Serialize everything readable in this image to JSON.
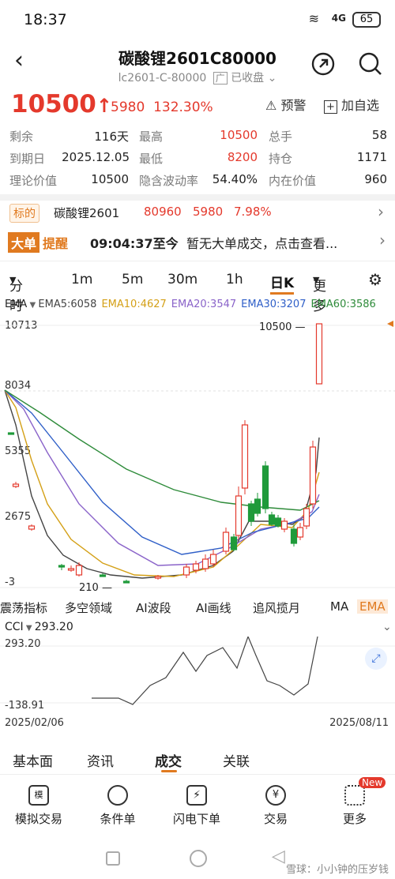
{
  "status_bar": {
    "time": "18:37",
    "battery": "65",
    "network": "4G"
  },
  "header": {
    "title": "碳酸锂2601C80000",
    "subtitle": "lc2601-C-80000",
    "exchange_tag": "广",
    "market_status": "已收盘"
  },
  "quote": {
    "price": "10500",
    "change": "5980",
    "change_pct": "132.30%",
    "alert_label": "预警",
    "watchlist_label": "加自选"
  },
  "stats": [
    {
      "label": "剩余",
      "value": "116天",
      "label2": "最高",
      "value2": "10500",
      "label3": "总手",
      "value3": "58"
    },
    {
      "label": "到期日",
      "value": "2025.12.05",
      "label2": "最低",
      "value2": "8200",
      "label3": "持仓",
      "value3": "1171"
    },
    {
      "label": "理论价值",
      "value": "10500",
      "label2": "隐含波动率",
      "value2": "54.40%",
      "label3": "内在价值",
      "value3": "960"
    }
  ],
  "underlying": {
    "tag": "标的",
    "name": "碳酸锂2601",
    "price": "80960",
    "change": "5980",
    "change_pct": "7.98%"
  },
  "big_order": {
    "tag1": "大单",
    "tag2": "提醒",
    "time": "09:04:37至今",
    "message": "暂无大单成交，点击查看..."
  },
  "periods": [
    "分时",
    "1m",
    "5m",
    "30m",
    "1h",
    "日K",
    "更多"
  ],
  "active_period": "日K",
  "ema_legend": {
    "name": "EMA",
    "items": [
      {
        "label": "EMA5:6058",
        "color": "#444444"
      },
      {
        "label": "EMA10:4627",
        "color": "#d4a017"
      },
      {
        "label": "EMA20:3547",
        "color": "#8a63c9"
      },
      {
        "label": "EMA30:3207",
        "color": "#2f5fc8"
      },
      {
        "label": "EMA60:3586",
        "color": "#2e8b3a"
      }
    ]
  },
  "price_axis": [
    "10713",
    "8034",
    "5355",
    "2675",
    "-3"
  ],
  "annotations": {
    "high": "10500",
    "low": "210"
  },
  "tools": [
    "震荡指标",
    "多空领域",
    "AI波段",
    "AI画线",
    "追风揽月",
    "MA",
    "EMA"
  ],
  "cci": {
    "name": "CCI",
    "value": "293.20",
    "top": "293.20",
    "bottom": "-138.91"
  },
  "dates": {
    "start": "2025/02/06",
    "end": "2025/08/11"
  },
  "bottom_tabs": [
    "基本面",
    "资讯",
    "成交",
    "关联"
  ],
  "active_bottom_tab": "成交",
  "bottom_bar": [
    {
      "label": "模拟交易",
      "icon": "simulate-trade-icon"
    },
    {
      "label": "条件单",
      "icon": "cloud-condition-icon"
    },
    {
      "label": "闪电下单",
      "icon": "lightning-order-icon"
    },
    {
      "label": "交易",
      "icon": "trade-yen-icon"
    },
    {
      "label": "更多",
      "icon": "grid-more-icon",
      "badge": "New"
    }
  ],
  "watermark": "雪球：小小钟的压岁钱",
  "colors": {
    "up": "#e4392c",
    "down": "#1f9a3a",
    "accent": "#e07a20"
  },
  "chart_data": {
    "type": "candlestick",
    "ylim": [
      -3,
      10713
    ],
    "ema_latest": {
      "EMA5": 6058,
      "EMA10": 4627,
      "EMA20": 3547,
      "EMA30": 3207,
      "EMA60": 3586
    },
    "last_close": 10500,
    "low_marked": 210
  }
}
